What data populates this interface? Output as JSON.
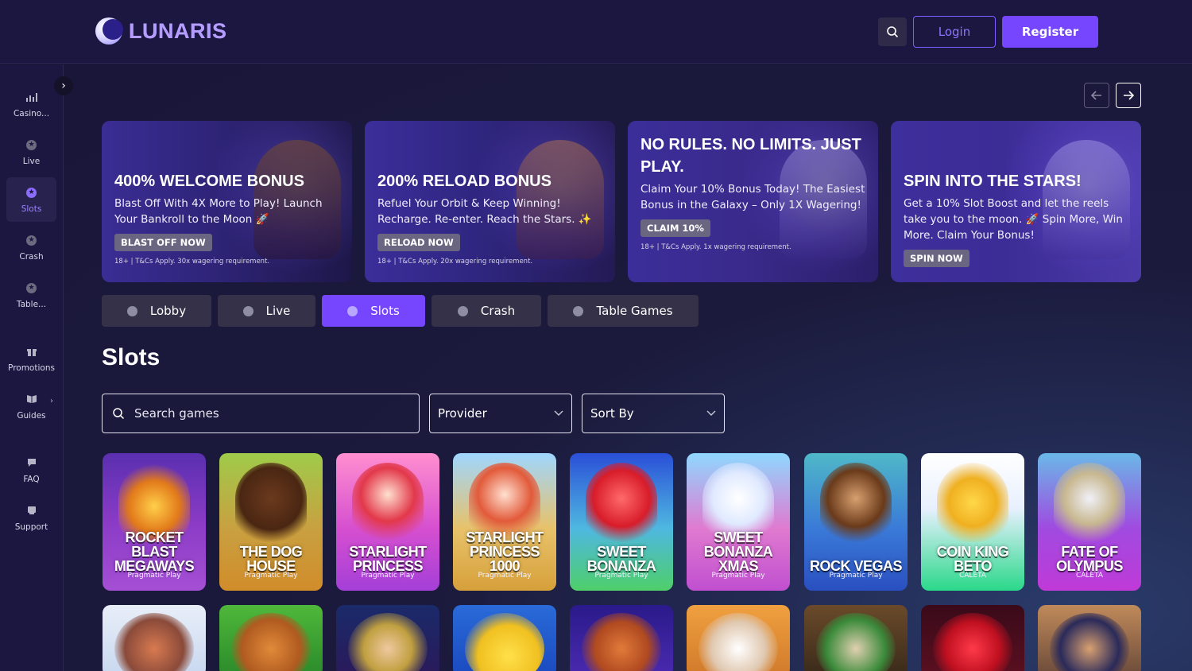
{
  "header": {
    "logo_text": "LUNARIS",
    "login_label": "Login",
    "register_label": "Register"
  },
  "sidebar": {
    "items": [
      {
        "label": "Casino...",
        "icon": "chart-icon"
      },
      {
        "label": "Live",
        "icon": "star-icon"
      },
      {
        "label": "Slots",
        "icon": "star-icon",
        "active": true
      },
      {
        "label": "Crash",
        "icon": "star-icon"
      },
      {
        "label": "Table...",
        "icon": "star-icon"
      },
      {
        "label": "Promotions",
        "icon": "gift-icon"
      },
      {
        "label": "Guides",
        "icon": "book-icon"
      },
      {
        "label": "FAQ",
        "icon": "chat-icon"
      },
      {
        "label": "Support",
        "icon": "support-icon"
      }
    ]
  },
  "banners": [
    {
      "title": "400% WELCOME BONUS",
      "text": "Blast Off With 4X More to Play! Launch Your Bankroll to the Moon 🚀",
      "cta": "BLAST OFF NOW",
      "terms": "18+ | T&Cs Apply. 30x wagering requirement."
    },
    {
      "title": "200% RELOAD BONUS",
      "text": "Refuel Your Orbit & Keep Winning! Recharge. Re-enter. Reach the Stars. ✨",
      "cta": "RELOAD NOW",
      "terms": "18+ | T&Cs Apply. 20x wagering requirement."
    },
    {
      "title": "NO RULES. NO LIMITS. JUST PLAY.",
      "text": "Claim Your 10% Bonus Today! The Easiest Bonus in the Galaxy – Only 1X Wagering!",
      "cta": "CLAIM 10%",
      "terms": "18+ | T&Cs Apply. 1x wagering requirement."
    },
    {
      "title": "SPIN INTO THE STARS!",
      "text": "Get a 10% Slot Boost and let the reels take you to the moon. 🚀 Spin More, Win More. Claim Your Bonus!",
      "cta": "SPIN NOW",
      "terms": ""
    }
  ],
  "tabs": [
    "Lobby",
    "Live",
    "Slots",
    "Crash",
    "Table Games"
  ],
  "active_tab": "Slots",
  "section_title": "Slots",
  "filters": {
    "search_placeholder": "Search games",
    "provider_label": "Provider",
    "sort_label": "Sort By"
  },
  "games": [
    {
      "title": "ROCKET BLAST MEGAWAYS",
      "provider": "Pragmatic Play"
    },
    {
      "title": "THE DOG HOUSE",
      "provider": "Pragmatic Play"
    },
    {
      "title": "STARLIGHT PRINCESS",
      "provider": "Pragmatic Play"
    },
    {
      "title": "STARLIGHT PRINCESS 1000",
      "provider": "Pragmatic Play"
    },
    {
      "title": "SWEET BONANZA",
      "provider": "Pragmatic Play"
    },
    {
      "title": "SWEET BONANZA XMAS",
      "provider": "Pragmatic Play"
    },
    {
      "title": "ROCK VEGAS",
      "provider": "Pragmatic Play"
    },
    {
      "title": "COIN KING BETO",
      "provider": "CALETA"
    },
    {
      "title": "FATE OF OLYMPUS",
      "provider": "CALETA"
    }
  ],
  "colors": {
    "accent": "#7646ff",
    "background": "#1a1638",
    "sidebar": "#1c1740"
  }
}
